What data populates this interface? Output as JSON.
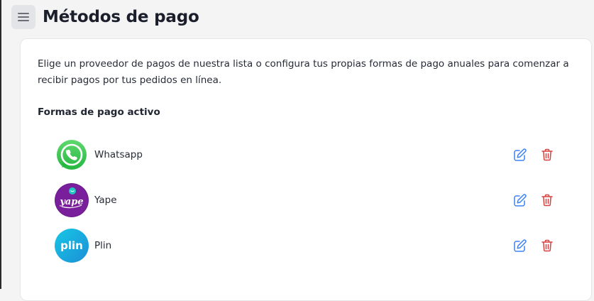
{
  "header": {
    "title": "Métodos de pago",
    "menu_icon": "hamburger-icon"
  },
  "card": {
    "intro": "Elige un proveedor de pagos de nuestra lista o configura tus propias formas de pago anuales para comenzar a recibir pagos por tus pedidos en línea.",
    "section_title": "Formas de pago activo",
    "methods": [
      {
        "name": "Whatsapp",
        "logo": "whatsapp-logo",
        "color": "#2fbe4f"
      },
      {
        "name": "Yape",
        "logo": "yape-logo",
        "color": "#6a1a8c",
        "logo_text": "yape"
      },
      {
        "name": "Plin",
        "logo": "plin-logo",
        "color": "#1aa7d8",
        "logo_text": "plin"
      }
    ]
  },
  "colors": {
    "edit_icon": "#3b82f6",
    "delete_icon": "#d94040",
    "background": "#f4f4f5",
    "card": "#ffffff"
  },
  "icons": {
    "edit": "edit-icon",
    "delete": "trash-icon"
  }
}
